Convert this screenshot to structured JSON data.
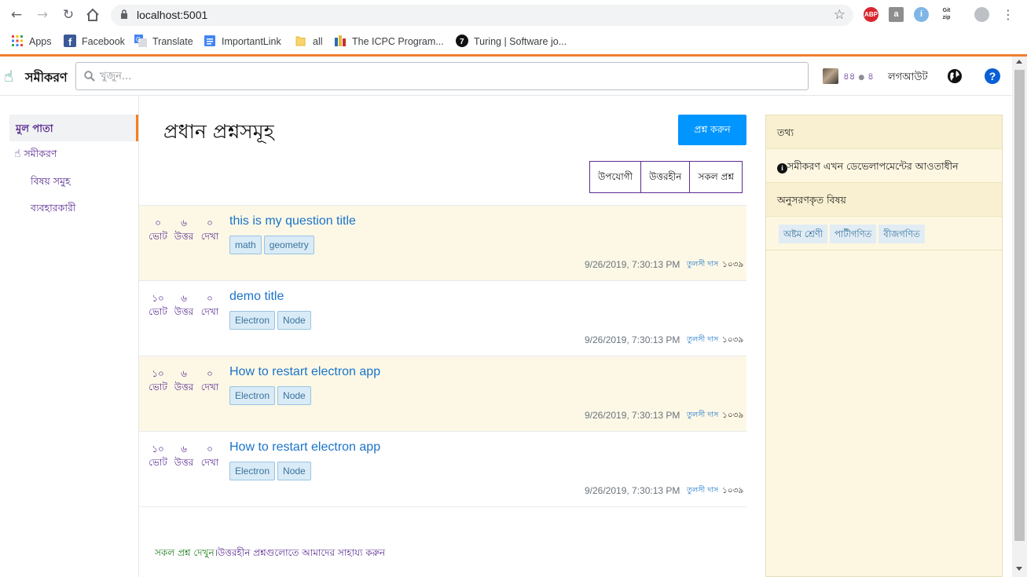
{
  "browser": {
    "url": "localhost:5001",
    "bookmarks": [
      {
        "label": "Apps",
        "icon": "apps-grid-icon"
      },
      {
        "label": "Facebook",
        "icon": "facebook-icon"
      },
      {
        "label": "Translate",
        "icon": "translate-icon"
      },
      {
        "label": "ImportantLink",
        "icon": "doc-icon"
      },
      {
        "label": "all",
        "icon": "folder-icon"
      },
      {
        "label": "The ICPC Program...",
        "icon": "icpc-icon"
      },
      {
        "label": "Turing | Software jo...",
        "icon": "turing-icon"
      }
    ],
    "extensions": [
      "ABP",
      "a",
      "i",
      "Git zip"
    ]
  },
  "topbar": {
    "logo": "সমীকরণ",
    "search_placeholder": "খুজুন...",
    "reputation": "৪৪",
    "badge_count": "৪",
    "logout": "লগআউট",
    "help": "?"
  },
  "leftnav": {
    "home": "মুল পাতা",
    "section": "সমীকরণ",
    "topics": "বিষয় সমুহ",
    "users": "ব্যবহারকারী"
  },
  "main": {
    "title": "প্রধান প্রশ্নসমূহ",
    "ask_button": "প্রশ্ন করুন",
    "filters": [
      "উপযোগী",
      "উত্তরহীন",
      "সকল প্রশ্ন"
    ],
    "stat_labels": {
      "votes": "ভোট",
      "answers": "উত্তর",
      "views": "দেখা"
    },
    "questions": [
      {
        "votes": "০",
        "answers": "৬",
        "views": "০",
        "title": "this is my question title",
        "tags": [
          "math",
          "geometry"
        ],
        "date": "9/26/2019, 7:30:13 PM",
        "user": "তুলসী দাস",
        "rep": "১০৩৯",
        "highlighted": true
      },
      {
        "votes": "১০",
        "answers": "৬",
        "views": "০",
        "title": "demo title",
        "tags": [
          "Electron",
          "Node"
        ],
        "date": "9/26/2019, 7:30:13 PM",
        "user": "তুলসী দাস",
        "rep": "১০৩৯",
        "highlighted": false
      },
      {
        "votes": "১০",
        "answers": "৬",
        "views": "০",
        "title": "How to restart electron app",
        "tags": [
          "Electron",
          "Node"
        ],
        "date": "9/26/2019, 7:30:13 PM",
        "user": "তুলসী দাস",
        "rep": "১০৩৯",
        "highlighted": true
      },
      {
        "votes": "১০",
        "answers": "৬",
        "views": "০",
        "title": "How to restart electron app",
        "tags": [
          "Electron",
          "Node"
        ],
        "date": "9/26/2019, 7:30:13 PM",
        "user": "তুলসী দাস",
        "rep": "১০৩৯",
        "highlighted": false
      }
    ],
    "footer_link": "সকল প্রশ্ন দেখুন",
    "footer_separator": "।",
    "footer_text": "উত্তরহীন প্রশ্নগুলোতে আমাদের সাহায্য করুন"
  },
  "sidebar": {
    "info_header": "তথ্য",
    "info_text": "সমীকরণ এখন ডেভেলাপমেন্টের আওতাধীন",
    "followed_header": "অনুসরণকৃত বিষয়",
    "followed_tags": [
      "অষ্টম শ্রেণী",
      "পাটীগণিত",
      "বীজগণিত"
    ]
  },
  "colors": {
    "accent_orange": "#f48024",
    "link_blue": "#1a73c9",
    "purple": "#5a2d91",
    "ask_button": "#0095ff",
    "highlight_row": "#fdf8e6",
    "sidebar_bg": "#fdf7e2"
  }
}
